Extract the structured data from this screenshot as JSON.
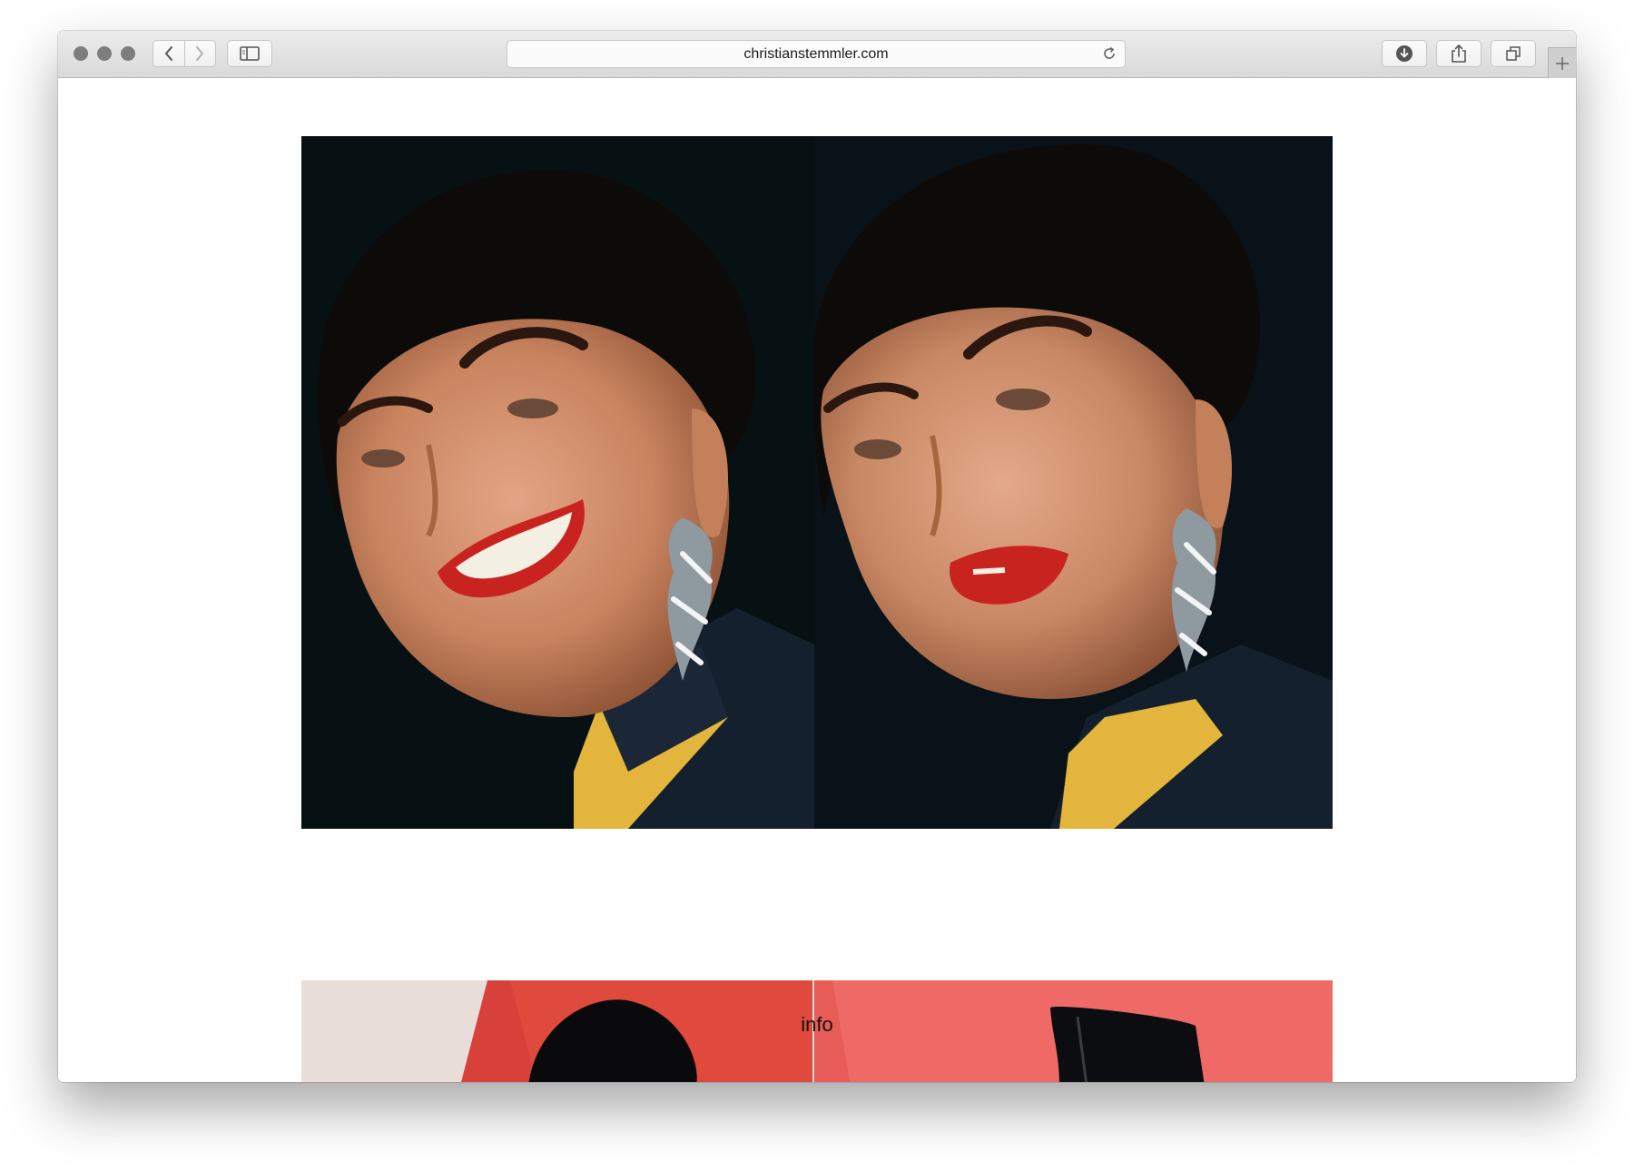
{
  "browser": {
    "url": "christianstemmler.com"
  },
  "page": {
    "info_link": "info"
  },
  "colors": {
    "portrait_background": "#081014",
    "lipstick": "#c9231f",
    "sweater": "#e3b53c",
    "second_image_red": "#ef6a66"
  },
  "icons": [
    "close-icon",
    "minimize-icon",
    "zoom-icon",
    "back-icon",
    "forward-icon",
    "sidebar-icon",
    "reload-icon",
    "download-icon",
    "share-icon",
    "tabs-icon",
    "new-tab-icon"
  ]
}
